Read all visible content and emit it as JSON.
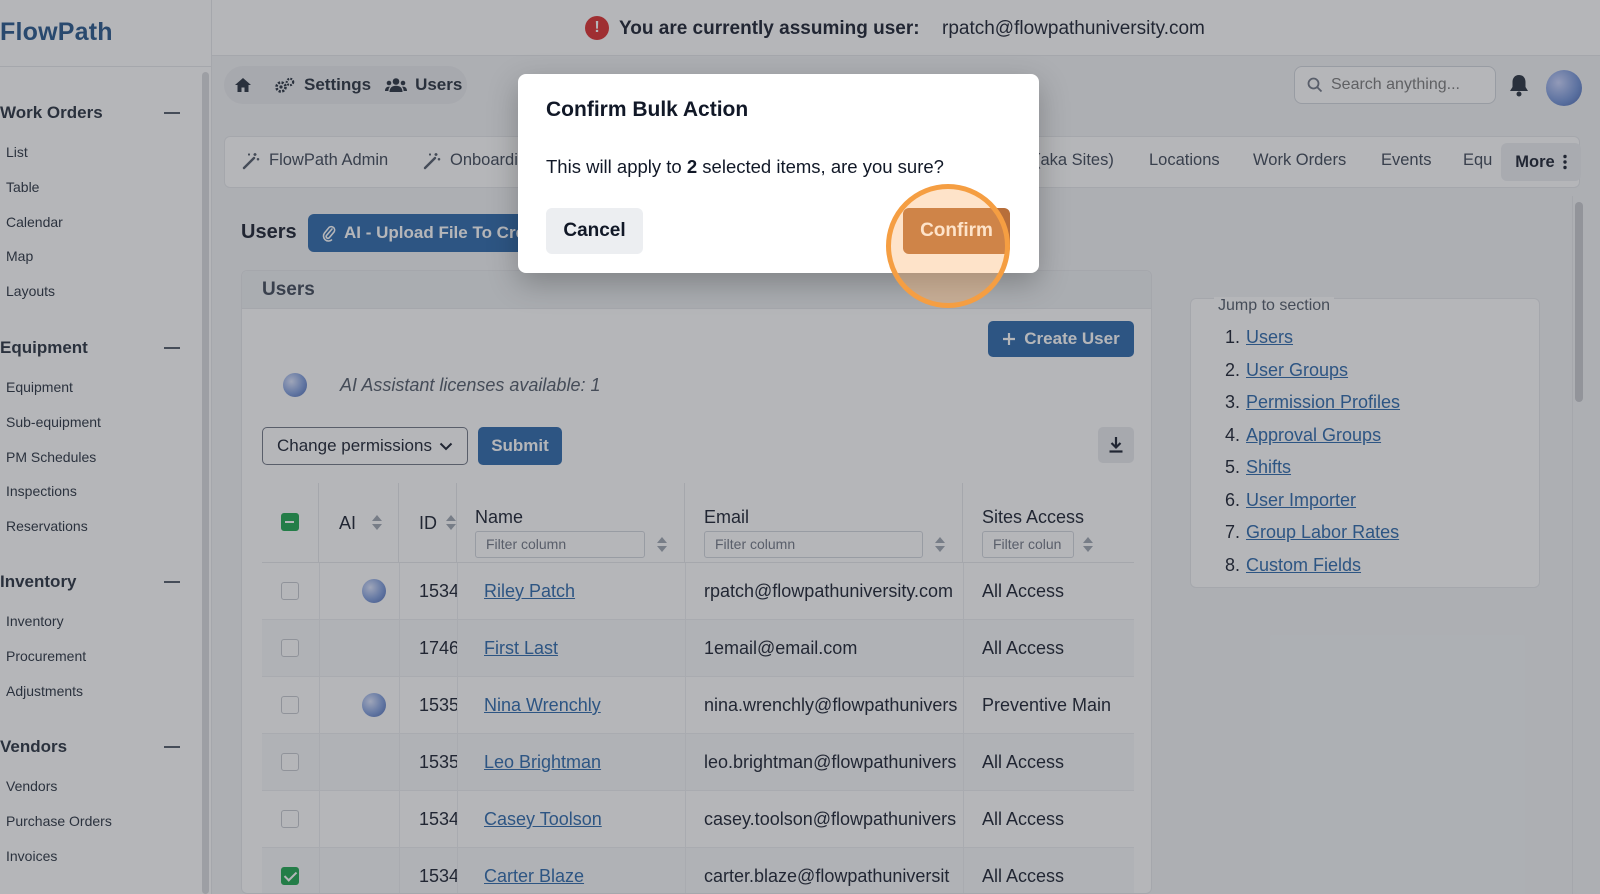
{
  "app": {
    "brand": "FlowPath"
  },
  "banner": {
    "label": "You are currently assuming user:",
    "user": "rpatch@flowpathuniversity.com",
    "warn_glyph": "!"
  },
  "sidebar": {
    "sections": [
      {
        "title": "Work Orders",
        "items": [
          "List",
          "Table",
          "Calendar",
          "Map",
          "Layouts"
        ]
      },
      {
        "title": "Equipment",
        "items": [
          "Equipment",
          "Sub-equipment",
          "PM Schedules",
          "Inspections",
          "Reservations"
        ]
      },
      {
        "title": "Inventory",
        "items": [
          "Inventory",
          "Procurement",
          "Adjustments"
        ]
      },
      {
        "title": "Vendors",
        "items": [
          "Vendors",
          "Purchase Orders",
          "Invoices"
        ]
      }
    ]
  },
  "header": {
    "breadcrumb": {
      "settings": "Settings",
      "users": "Users"
    },
    "search_placeholder": "Search anything..."
  },
  "tabs": {
    "items": [
      "FlowPath Admin",
      "Onboardi",
      "(aka Sites)",
      "Locations",
      "Work Orders",
      "Events",
      "Equ"
    ],
    "more": "More"
  },
  "page": {
    "title": "Users",
    "ai_upload_label": "AI - Upload File To Cre"
  },
  "users_card": {
    "title": "Users",
    "create_user": "Create User",
    "ai_licenses": "AI Assistant licenses available: 1",
    "permissions_select": "Change permissions",
    "submit": "Submit"
  },
  "table": {
    "columns": {
      "ai": "AI",
      "id": "ID",
      "name": "Name",
      "email": "Email",
      "sites": "Sites Access"
    },
    "filter_placeholder": "Filter column",
    "filter_placeholder_short": "Filter colun",
    "rows": [
      {
        "ai": true,
        "id": "1534",
        "name": "Riley Patch",
        "email": "rpatch@flowpathuniversity.com",
        "sites": "All Access",
        "checked": false
      },
      {
        "ai": false,
        "id": "1746",
        "name": "First Last",
        "email": "1email@email.com",
        "sites": "All Access",
        "checked": false
      },
      {
        "ai": true,
        "id": "1535",
        "name": "Nina Wrenchly",
        "email": "nina.wrenchly@flowpathunivers",
        "sites": "Preventive Main",
        "checked": false
      },
      {
        "ai": false,
        "id": "1535",
        "name": "Leo Brightman",
        "email": "leo.brightman@flowpathunivers",
        "sites": "All Access",
        "checked": false
      },
      {
        "ai": false,
        "id": "1534",
        "name": "Casey Toolson",
        "email": "casey.toolson@flowpathunivers",
        "sites": "All Access",
        "checked": false
      },
      {
        "ai": false,
        "id": "1534",
        "name": "Carter Blaze",
        "email": "carter.blaze@flowpathuniversit",
        "sites": "All Access",
        "checked": true
      }
    ]
  },
  "jump": {
    "title": "Jump to section",
    "items": [
      "Users",
      "User Groups",
      "Permission Profiles",
      "Approval Groups",
      "Shifts",
      "User Importer",
      "Group Labor Rates",
      "Custom Fields"
    ]
  },
  "modal": {
    "title": "Confirm Bulk Action",
    "text_before": "This will apply to",
    "count": "2",
    "text_after": "selected items, are you sure?",
    "cancel": "Cancel",
    "confirm": "Confirm"
  },
  "colors": {
    "brand": "#1e4f86",
    "primary": "#2563a8",
    "confirm": "#b76e3a",
    "check": "#16a34a",
    "highlight": "#f59e42"
  }
}
